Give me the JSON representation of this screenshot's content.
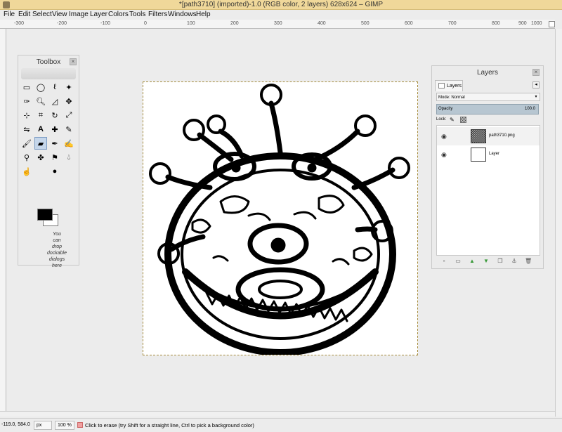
{
  "window": {
    "title": "*[path3710] (imported)-1.0 (RGB color, 2 layers) 628x624 – GIMP"
  },
  "menu": [
    "File",
    "Edit",
    "Select",
    "View",
    "Image",
    "Layer",
    "Colors",
    "Tools",
    "Filters",
    "Windows",
    "Help"
  ],
  "ruler": {
    "ticks": [
      "-300",
      "-200",
      "-100",
      "0",
      "100",
      "200",
      "300",
      "400",
      "500",
      "600",
      "700",
      "800",
      "900",
      "1000"
    ]
  },
  "toolbox": {
    "title": "Toolbox",
    "tools": [
      "rect-select",
      "ellipse-select",
      "free-select",
      "fuzzy-select",
      "color-picker",
      "zoom",
      "measure",
      "move",
      "align",
      "crop",
      "rotate",
      "scale",
      "flip",
      "text",
      "heal",
      "paint",
      "eraser",
      "smudge",
      "dodge",
      "blend",
      "pencil",
      "airbrush",
      "ink",
      "clone",
      "perspective-clone",
      "blur",
      "foreground-select",
      "paths"
    ],
    "active_tool": "eraser",
    "fg_color": "#000000",
    "bg_color": "#ffffff",
    "dock_hint": "You\ncan\ndrop\ndockable\ndialogs\nhere"
  },
  "layers_panel": {
    "title": "Layers",
    "tab_label": "Layers",
    "mode_label": "Mode:",
    "mode_value": "Normal",
    "opacity_label": "Opacity",
    "opacity_value": "100.0",
    "lock_label": "Lock:",
    "layers": [
      {
        "name": "path3710.png",
        "visible": true
      },
      {
        "name": "Layer",
        "visible": true
      }
    ]
  },
  "status": {
    "coords": "-119.0, 584.0",
    "unit": "px",
    "zoom": "100 %",
    "message": "Click to erase (try Shift for a straight line, Ctrl to pick a background color)"
  }
}
